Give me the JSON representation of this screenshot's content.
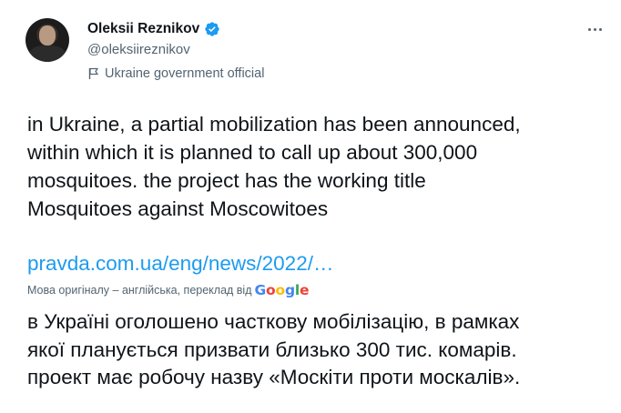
{
  "author": {
    "name": "Oleksii Reznikov",
    "handle": "@oleksiireznikov",
    "label": "Ukraine government official"
  },
  "icons": {
    "verified": "verified-badge-icon",
    "label": "flag-icon",
    "more": "more-icon"
  },
  "colors": {
    "accent": "#1d9bf0",
    "secondary_text": "#536471",
    "primary_text": "#0f1419"
  },
  "tweet": {
    "lines": [
      "in Ukraine, a partial mobilization has been announced,",
      "within which it is planned to call up about 300,000",
      "mosquitoes. the project has the working title",
      "Mosquitoes against Moscowitoes"
    ],
    "link_text": "pravda.com.ua/eng/news/2022/…"
  },
  "translation": {
    "note": "Мова оригіналу – англійська, переклад від",
    "provider": "Google",
    "lines": [
      "в Україні оголошено часткову мобілізацію, в рамках",
      "якої планується призвати близько 300 тис. комарів.",
      "проект має робочу назву «Москіти проти москалів»."
    ]
  }
}
